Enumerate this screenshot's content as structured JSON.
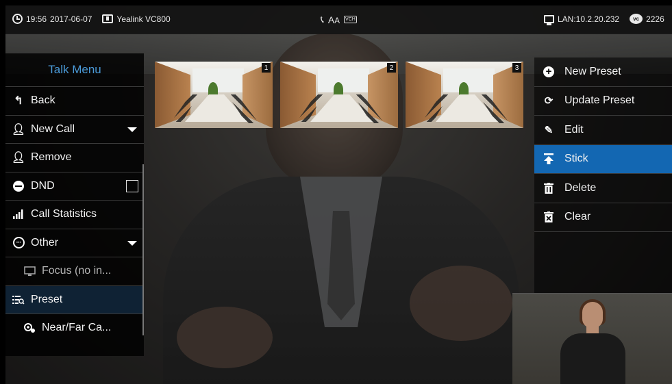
{
  "status_bar": {
    "time": "19:56",
    "date": "2017-06-07",
    "device_name": "Yealink VC800",
    "center_icons": [
      "phone-icon",
      "font-size-icon",
      "vch-icon"
    ],
    "vch_label": "VCH",
    "lan_label": "LAN:10.2.20.232",
    "vc_id": "2226",
    "vc_badge": "vc"
  },
  "talk_menu": {
    "title": "Talk Menu",
    "items": [
      {
        "label": "Back",
        "icon": "back-arrow-icon"
      },
      {
        "label": "New Call",
        "icon": "add-contact-icon",
        "has_dropdown": true
      },
      {
        "label": "Remove",
        "icon": "remove-contact-icon"
      },
      {
        "label": "DND",
        "icon": "dnd-icon",
        "checkbox": false
      },
      {
        "label": "Call Statistics",
        "icon": "signal-bars-icon"
      },
      {
        "label": "Other",
        "icon": "more-circle-icon",
        "has_dropdown": true
      },
      {
        "label": "Focus (no in...",
        "icon": "monitor-icon",
        "disabled": true
      },
      {
        "label": "Preset",
        "icon": "preset-list-icon",
        "active": true
      },
      {
        "label": "Near/Far Ca...",
        "icon": "camera-control-icon"
      }
    ]
  },
  "presets": [
    {
      "number": "1"
    },
    {
      "number": "2"
    },
    {
      "number": "3"
    }
  ],
  "preset_menu": {
    "items": [
      {
        "label": "New Preset",
        "icon": "plus-circle-icon"
      },
      {
        "label": "Update Preset",
        "icon": "refresh-icon"
      },
      {
        "label": "Edit",
        "icon": "pencil-icon"
      },
      {
        "label": "Stick",
        "icon": "stick-top-icon",
        "active": true
      },
      {
        "label": "Delete",
        "icon": "trash-icon"
      },
      {
        "label": "Clear",
        "icon": "clear-icon"
      }
    ]
  },
  "colors": {
    "accent": "#1367b2",
    "menu_title": "#4a9ad8",
    "active_row": "#0f2234"
  }
}
